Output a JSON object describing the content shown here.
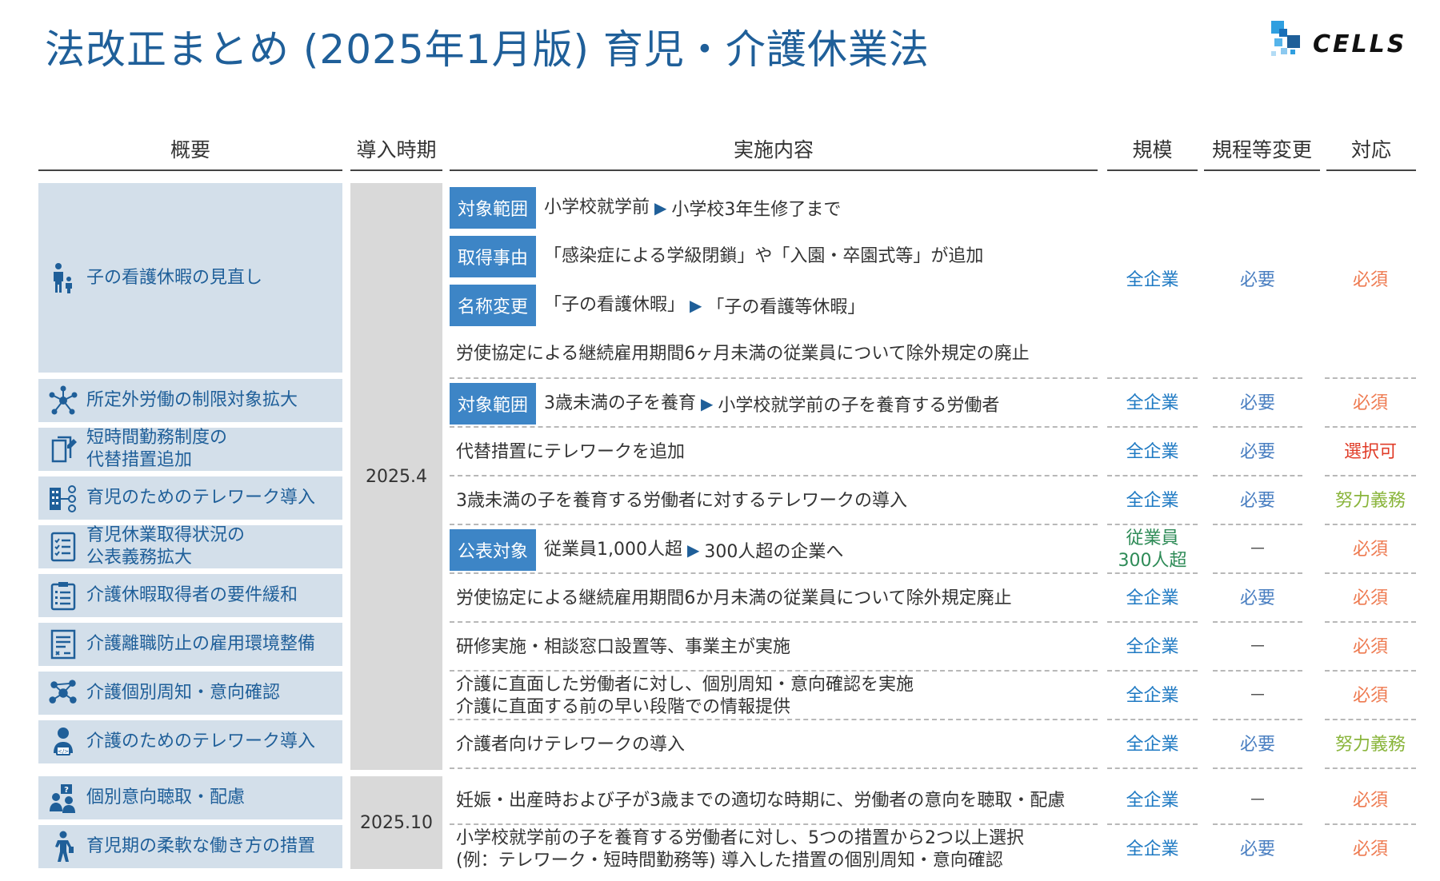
{
  "title": "法改正まとめ (2025年1月版) 育児・介護休業法",
  "logo": {
    "text": "CELLS"
  },
  "colors": {
    "title": "#1f5f99",
    "tag_bg": "#3d85c6",
    "overview_bg": "#d3dfea",
    "period_bg": "#d9d9d9",
    "scale_blue": "#1f7ac3",
    "scale_green": "#2e8b57",
    "rule_blue": "#4a7fc1",
    "must_orange": "#ee7a50",
    "select_red": "#e03c28",
    "effort_green": "#8ab53c",
    "dash_gray": "#888888"
  },
  "headers": {
    "overview": "概要",
    "period": "導入時期",
    "content": "実施内容",
    "scale": "規模",
    "rule_change": "規程等変更",
    "response": "対応"
  },
  "periods": [
    "2025.4",
    "2025.10"
  ],
  "overview": [
    {
      "icon": "parent-child-icon",
      "label": "子の看護休暇の見直し"
    },
    {
      "icon": "network-icon",
      "label": "所定外労働の制限対象拡大"
    },
    {
      "icon": "document-edit-icon",
      "label": "短時間勤務制度の\n代替措置追加"
    },
    {
      "icon": "building-network-icon",
      "label": "育児のためのテレワーク導入"
    },
    {
      "icon": "checklist-icon",
      "label": "育児休業取得状況の\n公表義務拡大"
    },
    {
      "icon": "clipboard-icon",
      "label": "介護休暇取得者の要件緩和"
    },
    {
      "icon": "form-icon",
      "label": "介護離職防止の雇用環境整備"
    },
    {
      "icon": "connections-icon",
      "label": "介護個別周知・意向確認"
    },
    {
      "icon": "remote-worker-icon",
      "label": "介護のためのテレワーク導入"
    },
    {
      "icon": "question-people-icon",
      "label": "個別意向聴取・配慮"
    },
    {
      "icon": "flexible-person-icon",
      "label": "育児期の柔軟な働き方の措置"
    }
  ],
  "first_group": {
    "rows": [
      {
        "tag": "対象範囲",
        "text": "小学校就学前",
        "arrow": "▶",
        "text2": "小学校3年生修了まで"
      },
      {
        "tag": "取得事由",
        "text": "「感染症による学級閉鎖」や「入園・卒園式等」が追加"
      },
      {
        "tag": "名称変更",
        "text": "「子の看護休暇」",
        "arrow": "▶",
        "text2": "「子の看護等休暇」"
      },
      {
        "text": "労使協定による継続雇用期間6ヶ月未満の従業員について除外規定の廃止"
      }
    ],
    "scale": "全企業",
    "rule": "必要",
    "response": "必須"
  },
  "rows": [
    {
      "tag": "対象範囲",
      "text": "3歳未満の子を養育",
      "arrow": "▶",
      "text2": "小学校就学前の子を養育する労働者",
      "scale": "全企業",
      "rule": "必要",
      "response": "必須",
      "resp_type": "must"
    },
    {
      "text": "代替措置にテレワークを追加",
      "scale": "全企業",
      "rule": "必要",
      "response": "選択可",
      "resp_type": "select"
    },
    {
      "text": "3歳未満の子を養育する労働者に対するテレワークの導入",
      "scale": "全企業",
      "rule": "必要",
      "response": "努力義務",
      "resp_type": "effort"
    },
    {
      "tag": "公表対象",
      "text": "従業員1,000人超",
      "arrow": "▶",
      "text2": "300人超の企業へ",
      "scale": "従業員\n300人超",
      "scale_type": "green",
      "rule": "－",
      "response": "必須",
      "resp_type": "must"
    },
    {
      "text": "労使協定による継続雇用期間6か月未満の従業員について除外規定廃止",
      "scale": "全企業",
      "rule": "必要",
      "response": "必須",
      "resp_type": "must"
    },
    {
      "text": "研修実施・相談窓口設置等、事業主が実施",
      "scale": "全企業",
      "rule": "－",
      "response": "必須",
      "resp_type": "must"
    },
    {
      "text": "介護に直面した労働者に対し、個別周知・意向確認を実施\n介護に直面する前の早い段階での情報提供",
      "scale": "全企業",
      "rule": "－",
      "response": "必須",
      "resp_type": "must"
    },
    {
      "text": "介護者向けテレワークの導入",
      "scale": "全企業",
      "rule": "必要",
      "response": "努力義務",
      "resp_type": "effort"
    },
    {
      "text": "妊娠・出産時および子が3歳までの適切な時期に、労働者の意向を聴取・配慮",
      "scale": "全企業",
      "rule": "－",
      "response": "必須",
      "resp_type": "must"
    },
    {
      "text": "小学校就学前の子を養育する労働者に対し、5つの措置から2つ以上選択\n(例：テレワーク・短時間勤務等) 導入した措置の個別周知・意向確認",
      "scale": "全企業",
      "rule": "必要",
      "response": "必須",
      "resp_type": "must"
    }
  ]
}
